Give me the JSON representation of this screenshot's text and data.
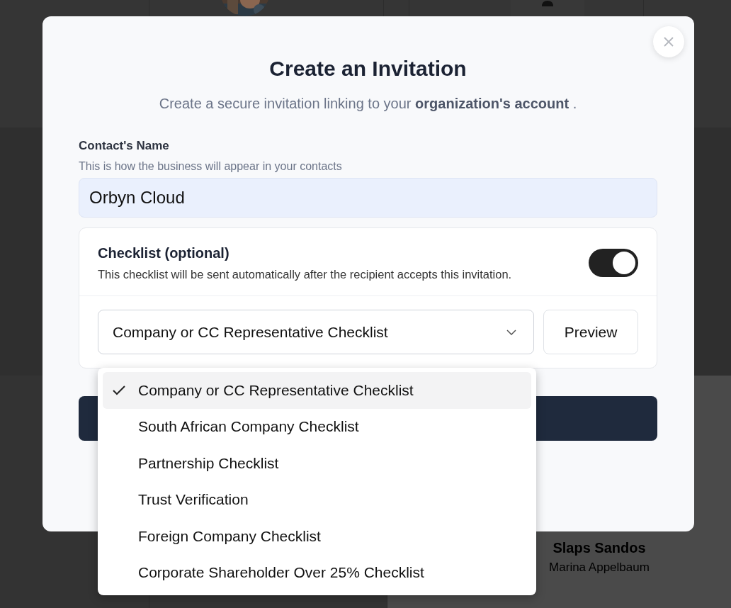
{
  "background": {
    "contact_card": {
      "name": "Slaps Sandos",
      "subtitle": "Marina Appelbaum"
    }
  },
  "modal": {
    "title": "Create an Invitation",
    "subtitle": "Create a secure invitation linking to your **organization's account** .",
    "contact_name": {
      "label": "Contact's Name",
      "hint": "This is how the business will appear in your contacts",
      "value": "Orbyn Cloud"
    },
    "checklist": {
      "title": "Checklist (optional)",
      "description": "This checklist will be sent automatically after the recipient accepts this invitation.",
      "enabled": true,
      "select": {
        "value": "Company or CC Representative Checklist",
        "expanded": true
      },
      "preview_button": "Preview",
      "options": [
        {
          "label": "Company or CC Representative Checklist",
          "selected": true
        },
        {
          "label": "South African Company Checklist",
          "selected": false
        },
        {
          "label": "Partnership Checklist",
          "selected": false
        },
        {
          "label": "Trust Verification",
          "selected": false
        },
        {
          "label": "Foreign Company Checklist",
          "selected": false
        },
        {
          "label": "Corporate Shareholder Over 25% Checklist",
          "selected": false
        }
      ]
    }
  }
}
